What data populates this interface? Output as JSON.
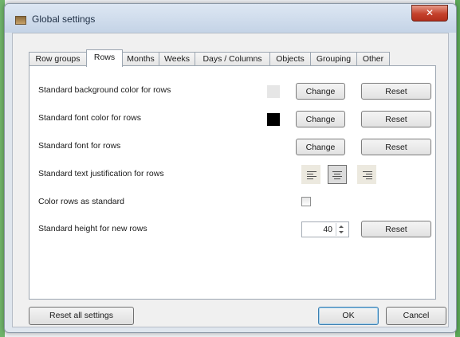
{
  "window": {
    "title": "Global settings",
    "close_glyph": "✕"
  },
  "tabs": [
    {
      "label": "Row groups",
      "active": false
    },
    {
      "label": "Rows",
      "active": true
    },
    {
      "label": "Months",
      "active": false
    },
    {
      "label": "Weeks",
      "active": false
    },
    {
      "label": "Days / Columns",
      "active": false
    },
    {
      "label": "Objects",
      "active": false
    },
    {
      "label": "Grouping",
      "active": false
    },
    {
      "label": "Other",
      "active": false
    }
  ],
  "rows": {
    "bg_color": {
      "label": "Standard background color for rows",
      "swatch_color": "#e6e6e6",
      "change_label": "Change",
      "reset_label": "Reset"
    },
    "font_color": {
      "label": "Standard font color for rows",
      "swatch_color": "#000000",
      "change_label": "Change",
      "reset_label": "Reset"
    },
    "font": {
      "label": "Standard font for rows",
      "change_label": "Change",
      "reset_label": "Reset"
    },
    "justification": {
      "label": "Standard text justification for rows",
      "options": [
        "align-left-icon",
        "align-center-icon",
        "align-right-icon"
      ],
      "selected": "center"
    },
    "color_rows": {
      "label": "Color rows as standard",
      "checked": false
    },
    "height": {
      "label": "Standard height for new rows",
      "value": "40",
      "reset_label": "Reset"
    }
  },
  "footer": {
    "reset_all_label": "Reset all settings",
    "ok_label": "OK",
    "cancel_label": "Cancel"
  },
  "colors": {
    "title_bar": "#c4d3e6",
    "close_button": "#c4412c",
    "default_button_border": "#3c7fb1"
  }
}
